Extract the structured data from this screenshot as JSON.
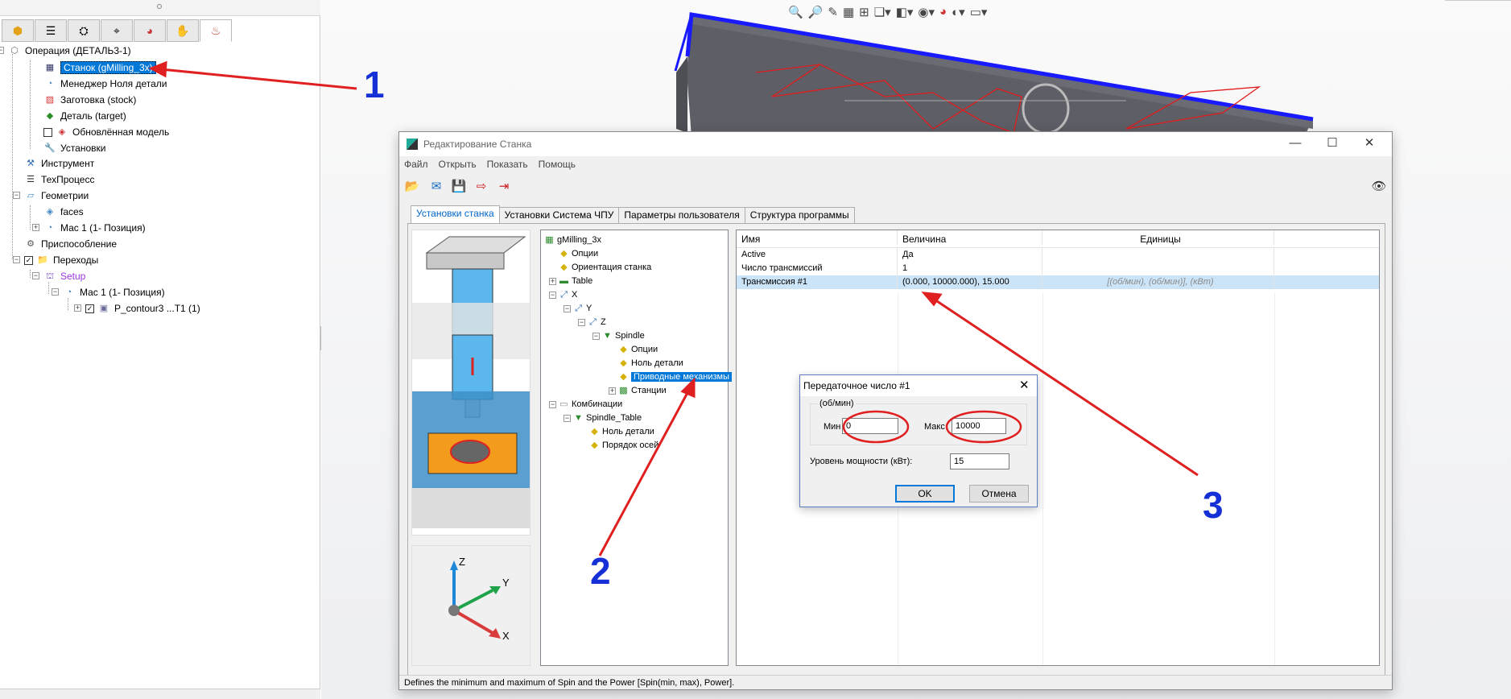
{
  "feature_tree": {
    "items": [
      {
        "label": "Операция (ДЕТАЛЬ3-1)",
        "icon": "operation-icon"
      },
      {
        "label": "Станок (gMilling_3x)",
        "icon": "machine-icon"
      },
      {
        "label": "Менеджер Ноля детали",
        "icon": "zero-manager-icon"
      },
      {
        "label": "Заготовка (stock)",
        "icon": "stock-icon"
      },
      {
        "label": "Деталь (target)",
        "icon": "part-icon"
      },
      {
        "label": "Обновлённая модель",
        "icon": "updated-model-icon"
      },
      {
        "label": "Установки",
        "icon": "settings-icon"
      },
      {
        "label": "Инструмент",
        "icon": "tool-icon"
      },
      {
        "label": "ТехПроцесс",
        "icon": "process-icon"
      },
      {
        "label": "Геометрии",
        "icon": "geometry-icon"
      },
      {
        "label": "faces",
        "icon": "faces-icon"
      },
      {
        "label": "Мас 1 (1- Позиция)",
        "icon": "coordinate-system-icon"
      },
      {
        "label": "Приспособление",
        "icon": "fixture-icon"
      },
      {
        "label": "Переходы",
        "icon": "folder-icon"
      },
      {
        "label": "Setup",
        "icon": "setup-icon"
      },
      {
        "label": "Мас 1 (1- Позиция)",
        "icon": "coordinate-system-icon"
      },
      {
        "label": "P_contour3 ...T1 (1)",
        "icon": "contour-operation-icon"
      }
    ]
  },
  "dialog": {
    "title": "Редактирование Станка",
    "menu": [
      "Файл",
      "Открыть",
      "Показать",
      "Помощь"
    ],
    "tabs": [
      "Установки станка",
      "Установки Система ЧПУ",
      "Параметры пользователя",
      "Структура программы"
    ],
    "tree": [
      "gMilling_3x",
      "Опции",
      "Ориентация станка",
      "Table",
      "X",
      "Y",
      "Z",
      "Spindle",
      "Опции",
      "Ноль детали",
      "Приводные механизмы",
      "Станции",
      "Комбинации",
      "Spindle_Table",
      "Ноль детали",
      "Порядок осей"
    ],
    "grid": {
      "headers": [
        "Имя",
        "Величина",
        "Единицы"
      ],
      "rows": [
        {
          "name": "Active",
          "value": "Да",
          "units": ""
        },
        {
          "name": "Число трансмиссий",
          "value": "1",
          "units": ""
        },
        {
          "name": "Трансмиссия #1",
          "value": "(0.000, 10000.000), 15.000",
          "units": "[(об/мин), (об/мин)], (кВт)"
        }
      ]
    },
    "status": "Defines the minimum and maximum of Spin and the Power [Spin(min, max), Power]."
  },
  "subdialog": {
    "title": "Передаточное число #1",
    "group": "(об/мин)",
    "min_label": "Мин",
    "min_value": "0",
    "max_label": "Макс",
    "max_value": "10000",
    "power_label": "Уровень мощности (кВт):",
    "power_value": "15",
    "ok": "OK",
    "cancel": "Отмена"
  },
  "axis_triad": {
    "z": "Z",
    "y": "Y",
    "x": "X"
  },
  "view_triad": {
    "x": "X",
    "y": "Y"
  },
  "annotations": {
    "one": "1",
    "two": "2",
    "three": "3"
  },
  "colors": {
    "selection": "#0078d7",
    "annotation_arrow": "#e02020",
    "annotation_number": "#1530d6",
    "part_edge": "#1a1aff"
  }
}
